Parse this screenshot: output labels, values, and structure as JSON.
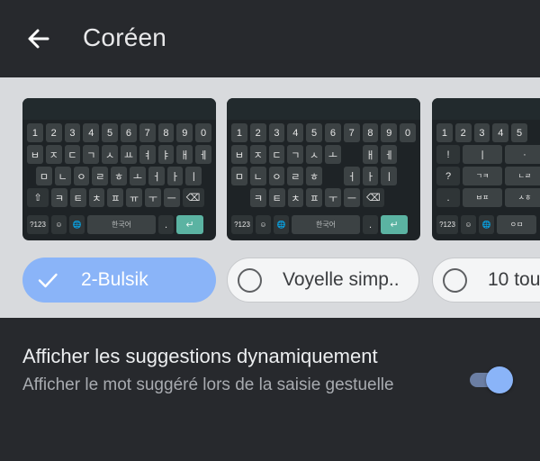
{
  "header": {
    "title": "Coréen",
    "back_icon": "arrow-back-icon"
  },
  "layouts": [
    {
      "label": "2-Bulsik",
      "selected": true,
      "rows": [
        [
          "1",
          "2",
          "3",
          "4",
          "5",
          "6",
          "7",
          "8",
          "9",
          "0"
        ],
        [
          "ㅂ",
          "ㅈ",
          "ㄷ",
          "ㄱ",
          "ㅅ",
          "ㅛ",
          "ㅕ",
          "ㅑ",
          "ㅐ",
          "ㅔ"
        ],
        [
          "ㅁ",
          "ㄴ",
          "ㅇ",
          "ㄹ",
          "ㅎ",
          "ㅗ",
          "ㅓ",
          "ㅏ",
          "ㅣ"
        ],
        [
          "⇧",
          "ㅋ",
          "ㅌ",
          "ㅊ",
          "ㅍ",
          "ㅠ",
          "ㅜ",
          "ㅡ",
          "⌫"
        ],
        [
          "?123",
          "☺",
          "🌐",
          "한국어",
          ".",
          "↵"
        ]
      ]
    },
    {
      "label": "Voyelle simp..",
      "selected": false,
      "rows": [
        [
          "1",
          "2",
          "3",
          "4",
          "5",
          "6",
          "7",
          "8",
          "9",
          "0"
        ],
        [
          "ㅂ",
          "ㅈ",
          "ㄷ",
          "ㄱ",
          "ㅅ",
          "ㅗ",
          "ㅐ",
          "ㅔ"
        ],
        [
          "ㅁ",
          "ㄴ",
          "ㅇ",
          "ㄹ",
          "ㅎ",
          "ㅓ",
          "ㅏ",
          "ㅣ"
        ],
        [
          "ㅋ",
          "ㅌ",
          "ㅊ",
          "ㅍ",
          "ㅜ",
          "ㅡ",
          "⌫"
        ],
        [
          "?123",
          "☺",
          "🌐",
          "한국어",
          ".",
          "↵"
        ]
      ]
    },
    {
      "label": "10 tou",
      "selected": false,
      "rows": [
        [
          "1",
          "2",
          "3",
          "4",
          "5"
        ],
        [
          "!",
          "ㅣ",
          "·"
        ],
        [
          "?",
          "ㄱㅋ",
          "ㄴㄹ"
        ],
        [
          ".",
          "ㅂㅍ",
          "ㅅㅎ"
        ],
        [
          "?123",
          "☺",
          "🌐",
          "ㅇㅁ"
        ]
      ]
    }
  ],
  "setting": {
    "title": "Afficher les suggestions dynamiquement",
    "description": "Afficher le mot suggéré lors de la saisie gestuelle",
    "toggle_on": true
  },
  "colors": {
    "accent": "#8ab4f8",
    "enter_key": "#5bb3a2",
    "background": "#27292d",
    "layout_area": "#d8dadd"
  }
}
